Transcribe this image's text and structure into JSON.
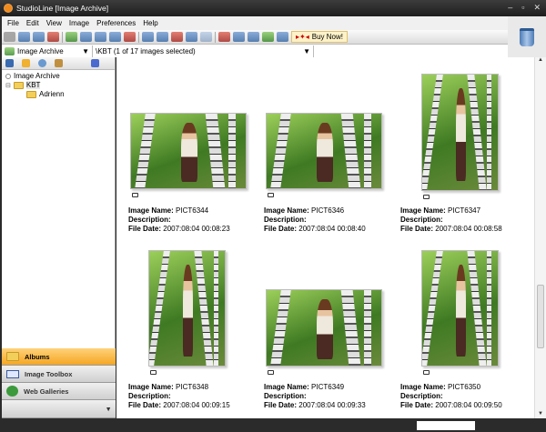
{
  "window": {
    "title": "StudioLine [Image Archive]"
  },
  "menu": [
    "File",
    "Edit",
    "View",
    "Image",
    "Preferences",
    "Help"
  ],
  "toolbar": {
    "buy_now": "Buy Now!"
  },
  "address": {
    "archive": "Image Archive",
    "path": "\\KBT (1 of 17 images selected)"
  },
  "tree": {
    "root": "Image Archive",
    "folder": "KBT",
    "subfolder": "Adrienn"
  },
  "nav": {
    "albums": "Albums",
    "toolbox": "Image Toolbox",
    "galleries": "Web Galleries"
  },
  "labels": {
    "name": "Image Name:",
    "desc": "Description:",
    "date": "File Date:"
  },
  "images": [
    {
      "name": "PICT6344",
      "date": "2007:08:04 00:08:23"
    },
    {
      "name": "PICT6346",
      "date": "2007:08:04 00:08:40"
    },
    {
      "name": "PICT6347",
      "date": "2007:08:04 00:08:58"
    },
    {
      "name": "PICT6348",
      "date": "2007:08:04 00:09:15"
    },
    {
      "name": "PICT6349",
      "date": "2007:08:04 00:09:33"
    },
    {
      "name": "PICT6350",
      "date": "2007:08:04 00:09:50"
    }
  ]
}
